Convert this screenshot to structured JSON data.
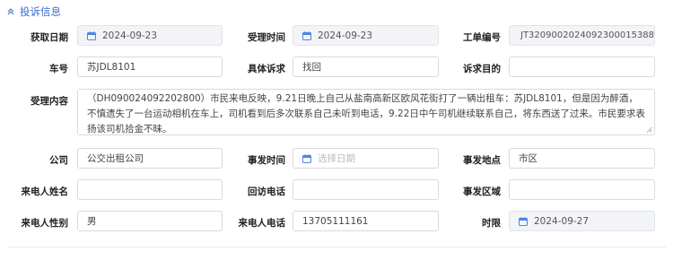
{
  "section": {
    "title": "投诉信息"
  },
  "fields": {
    "acquire_date": {
      "label": "获取日期",
      "value": "2024-09-23"
    },
    "accept_time": {
      "label": "受理时间",
      "value": "2024-09-23"
    },
    "order_no": {
      "label": "工单编号",
      "value": "JT320900202409230001538​8"
    },
    "car_no": {
      "label": "车号",
      "value": "苏JDL8101"
    },
    "specific_appeal": {
      "label": "具体诉求",
      "value": "找回"
    },
    "appeal_purpose": {
      "label": "诉求目的",
      "value": ""
    },
    "accept_content": {
      "label": "受理内容",
      "value": "（DH090024092202800）市民来电反映，9.21日晚上自己从盐南高新区欧风花街打了一辆出租车：苏JDL8101，但是因为醉酒，不慎遗失了一台运动相机在车上，司机看到后多次联系自己未听到电话，9.22日中午司机继续联系自己，将东西送了过来。市民要求表扬该司机拾金不昧。"
    },
    "company": {
      "label": "公司",
      "value": "公交出租公司"
    },
    "incident_time": {
      "label": "事发时间",
      "placeholder": "选择日期"
    },
    "incident_place": {
      "label": "事发地点",
      "value": "市区"
    },
    "caller_name": {
      "label": "来电人姓名",
      "value": ""
    },
    "callback_phone": {
      "label": "回访电话",
      "value": ""
    },
    "incident_area": {
      "label": "事发区域",
      "value": ""
    },
    "caller_gender": {
      "label": "来电人性别",
      "value": "男"
    },
    "caller_phone": {
      "label": "来电人电话",
      "value": "13705111161"
    },
    "deadline": {
      "label": "时限",
      "value": "2024-09-27"
    }
  },
  "icons": {
    "collapse": "chevron-up-icon",
    "calendar": "calendar-icon"
  },
  "colors": {
    "accent": "#3a6bc8",
    "calendar": "#4a86e8",
    "disabled_bg": "#f2f4f7"
  }
}
